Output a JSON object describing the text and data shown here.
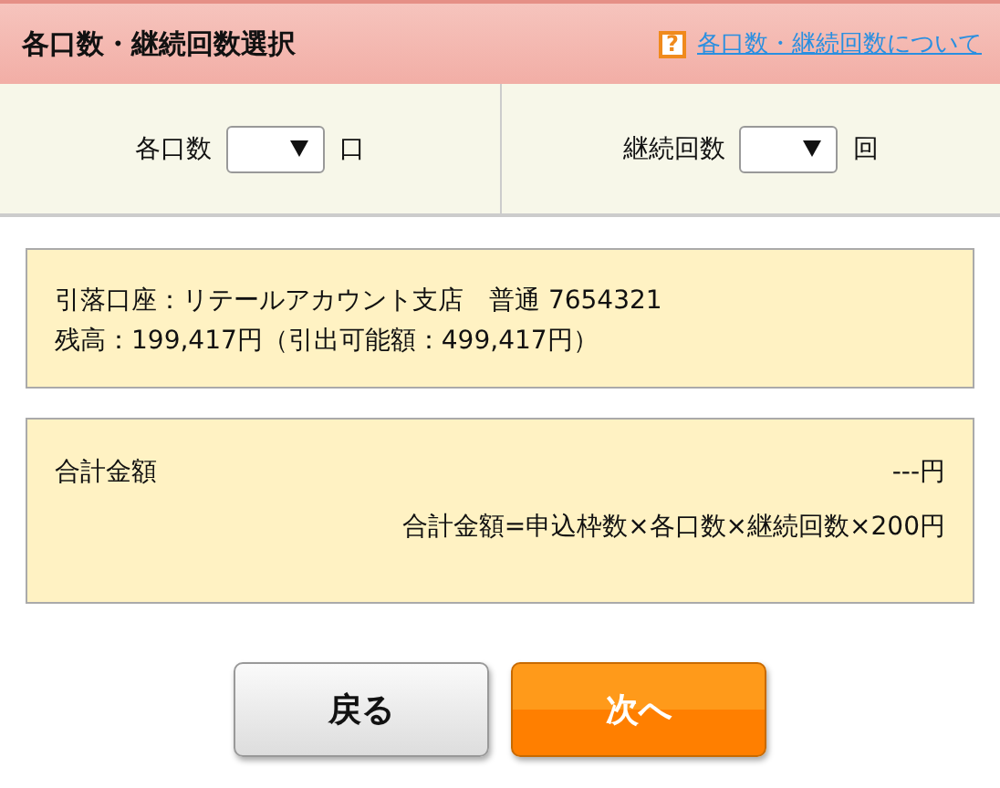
{
  "header": {
    "title": "各口数・継続回数選択",
    "help_mark": "?",
    "help_link": "各口数・継続回数について"
  },
  "selectors": [
    {
      "label": "各口数",
      "unit": "口"
    },
    {
      "label": "継続回数",
      "unit": "回"
    }
  ],
  "account": {
    "lines": [
      "引落口座：リテールアカウント支店　普通 7654321",
      "残高：199,417円（引出可能額：499,417円）"
    ]
  },
  "total": {
    "label": "合計金額",
    "value": "---円",
    "formula": "合計金額=申込枠数×各口数×継続回数×200円"
  },
  "buttons": [
    {
      "kind": "secondary",
      "label": "戻る"
    },
    {
      "kind": "primary",
      "label": "次へ"
    }
  ]
}
